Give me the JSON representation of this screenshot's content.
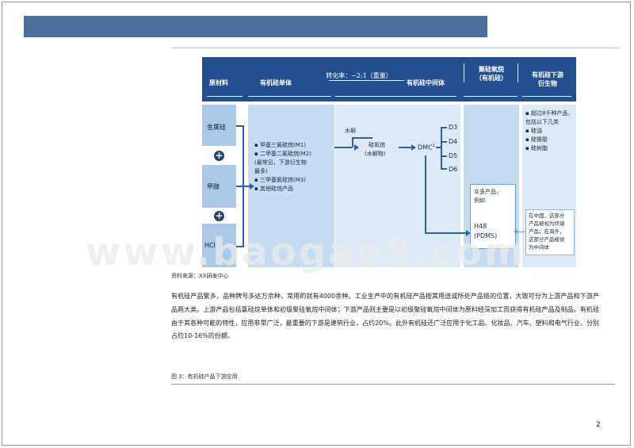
{
  "header": {
    "bar_color": "#4a6f9b"
  },
  "figure": {
    "header_color": "#234e8f",
    "columns": {
      "raw": "原材料",
      "monomer": "有机硅单体",
      "conversion": "转化率：~2:1（重量）",
      "intermediate": "有机硅中间体",
      "polysiloxane": "聚硅氧烷",
      "polysiloxane_sub": "（有机硅）",
      "downstream": "有机硅下游",
      "downstream_sub": "衍生物"
    },
    "raw_materials": [
      "金属硅",
      "甲醇",
      "HCl"
    ],
    "plus_symbol": "+",
    "monomers": [
      "▪ 甲基三氯硅烷(M1)",
      "▪ 二甲基二氯硅烷(M2)",
      "  (最常见，下游衍生物",
      "  最多)",
      "▪ 三甲基氯硅烷(M3)",
      "▪ 其他硅烷产品"
    ],
    "hydrolysis": "水解",
    "siloxane": "硅氧烷",
    "siloxane_sub": "(水解物)",
    "dmc": "DMC",
    "dmc_sup": "1",
    "cyclics": [
      "D3",
      "D4",
      "D5",
      "D6"
    ],
    "many_products": [
      "众多产品，",
      "例如"
    ],
    "h48": "H48",
    "pdms": "(PDMS)",
    "downstream_list": [
      "▪ 超过8千种产品，",
      "  包括以下几类",
      "  ▪ 硅油",
      "  ▪ 硅橡胶",
      "  ▪ 硅树脂"
    ],
    "china_note": [
      "在中国，这部分",
      "产品被视为终端",
      "产品；在海外，",
      "这部分产品被视",
      "为中间体"
    ]
  },
  "source_caption": "资料来源：XX研发中心",
  "paragraph": "有机硅产品繁多，品种牌号多达万余种，常用的就有4000余种。工业生产中的有机硅产品按其用途或所处产品链的位置，大致可分为上游产品和下游产品两大类。上游产品包括氯硅烷单体和初级聚硅氧烷中间体；下游产品则主要是以初级聚硅氧烷中间体为原料经深加工而获得有机硅产品及制品。有机硅由于其各种可能的特性，应用非常广泛，最重要的下游是建筑行业，占约20%。此外有机硅还广泛应用于化工品、化妆品、汽车、塑料和电气行业，分别占约10-16%的份额。",
  "figure3_caption": "图 3：有机硅产品下游应用",
  "page_number": "2",
  "watermark": "www.baogao8.com"
}
